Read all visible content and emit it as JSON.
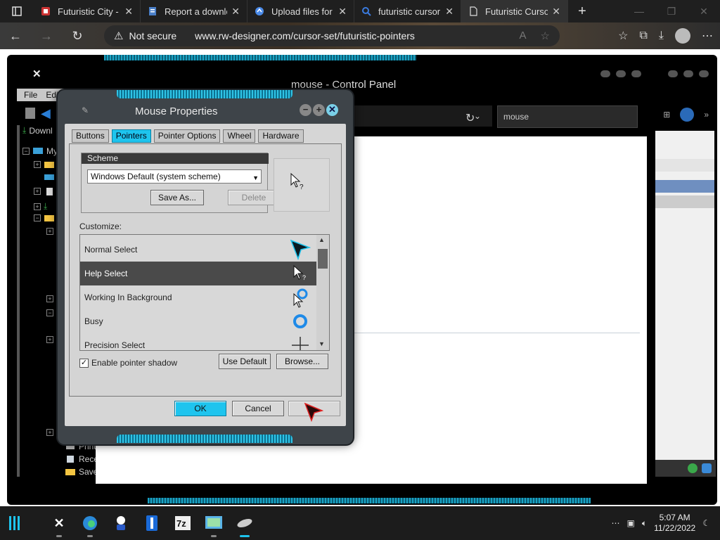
{
  "browser": {
    "tabs": [
      {
        "label": "Futuristic City - ",
        "icon": "page-icon"
      },
      {
        "label": "Report a downlo",
        "icon": "doc-icon"
      },
      {
        "label": "Upload files for",
        "icon": "upload-icon"
      },
      {
        "label": "futuristic cursor",
        "icon": "search-icon"
      },
      {
        "label": "Futuristic Cursor",
        "icon": "page-icon"
      }
    ],
    "not_secure": "Not secure",
    "url": "www.rw-designer.com/cursor-set/futuristic-pointers"
  },
  "control_panel": {
    "title": "mouse - Control Panel",
    "menu_file": "File",
    "menu_edit": "Edit",
    "search_value": "mouse",
    "tree": [
      "My",
      "Downl",
      "Print",
      "Rece",
      "Save"
    ]
  },
  "dialog": {
    "title": "Mouse Properties",
    "tabs": [
      "Buttons",
      "Pointers",
      "Pointer Options",
      "Wheel",
      "Hardware"
    ],
    "selected_tab": "Pointers",
    "scheme_header": "Scheme",
    "scheme_value": "Windows Default (system scheme)",
    "save_as": "Save As...",
    "delete": "Delete",
    "customize_label": "Customize:",
    "cursors": [
      {
        "name": "Normal Select",
        "icon": "arrow-cursor-icon"
      },
      {
        "name": "Help Select",
        "icon": "help-cursor-icon",
        "selected": true
      },
      {
        "name": "Working In Background",
        "icon": "working-cursor-icon"
      },
      {
        "name": "Busy",
        "icon": "busy-ring-icon"
      },
      {
        "name": "Precision Select",
        "icon": "crosshair-icon"
      }
    ],
    "enable_shadow": "Enable pointer shadow",
    "shadow_checked": true,
    "use_default": "Use Default",
    "browse": "Browse...",
    "ok": "OK",
    "cancel": "Cancel"
  },
  "taskbar": {
    "time": "5:07 AM",
    "date": "11/22/2022",
    "apps": [
      "start-icon",
      "xwidget-icon",
      "edge-icon",
      "bot-icon",
      "notepad-icon",
      "7zip-icon",
      "control-panel-icon",
      "mouse-icon"
    ]
  },
  "colors": {
    "accent": "#1ec4ee",
    "dialog_frame": "#3e4449",
    "selection": "#4a4a4a"
  }
}
